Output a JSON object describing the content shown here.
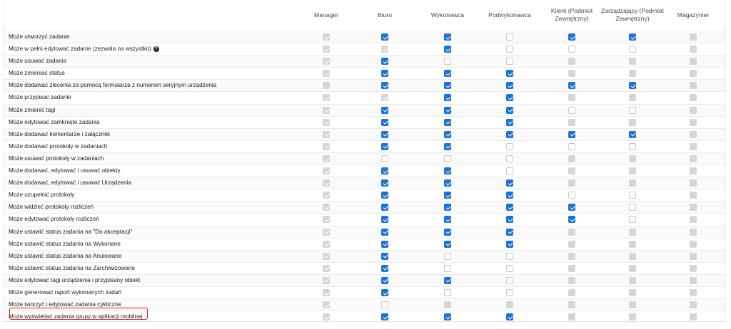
{
  "columns": [
    {
      "key": "manager",
      "label": "Manager"
    },
    {
      "key": "biuro",
      "label": "Biuro"
    },
    {
      "key": "wykonawca",
      "label": "Wykonawca"
    },
    {
      "key": "podwykonawca",
      "label": "Podwykonawca"
    },
    {
      "key": "klient",
      "label": "Klient (Podmiot Zewnętrzny)"
    },
    {
      "key": "zarzadzajacy",
      "label": "Zarządzający (Podmiot Zewnętrzny)"
    },
    {
      "key": "magazynier",
      "label": "Magazynier"
    }
  ],
  "legend": {
    "C": "checked",
    "U": "unchecked",
    "D": "disabled",
    "DC": "disabled-checked"
  },
  "permissions": [
    {
      "label": "Może utworzyć zadanie",
      "help": false,
      "states": [
        "DC",
        "C",
        "C",
        "U",
        "C",
        "C",
        "D"
      ]
    },
    {
      "label": "Może w pełni edytować zadanie (zezwala na wszystko)",
      "help": true,
      "states": [
        "DC",
        "DC",
        "C",
        "U",
        "U",
        "U",
        "D"
      ]
    },
    {
      "label": "Może usuwać zadania",
      "help": false,
      "states": [
        "DC",
        "C",
        "U",
        "U",
        "D",
        "D",
        "D"
      ]
    },
    {
      "label": "Może zmieniać status",
      "help": false,
      "states": [
        "DC",
        "C",
        "C",
        "C",
        "D",
        "D",
        "D"
      ]
    },
    {
      "label": "Może dodawać zlecenia za pomocą formularza z numerem seryjnym urządzenia",
      "help": false,
      "states": [
        "D",
        "C",
        "C",
        "C",
        "C",
        "C",
        "D"
      ]
    },
    {
      "label": "Może przypisać zadanie",
      "help": false,
      "states": [
        "DC",
        "DC",
        "C",
        "C",
        "D",
        "D",
        "D"
      ]
    },
    {
      "label": "Może zmienić tagi",
      "help": false,
      "states": [
        "DC",
        "C",
        "C",
        "C",
        "U",
        "U",
        "D"
      ]
    },
    {
      "label": "Może edytować zamknięte zadania",
      "help": false,
      "states": [
        "DC",
        "C",
        "C",
        "C",
        "D",
        "D",
        "D"
      ]
    },
    {
      "label": "Może dodawać komentarze i załączniki",
      "help": false,
      "states": [
        "DC",
        "C",
        "C",
        "C",
        "C",
        "C",
        "D"
      ]
    },
    {
      "label": "Może dodawać protokoły w zadaniach",
      "help": false,
      "states": [
        "DC",
        "C",
        "C",
        "U",
        "U",
        "U",
        "D"
      ]
    },
    {
      "label": "Może usuwać protokoły w zadaniach",
      "help": false,
      "states": [
        "DC",
        "U",
        "U",
        "U",
        "D",
        "D",
        "D"
      ]
    },
    {
      "label": "Może dodawać, edytować i usuwać obiekty",
      "help": false,
      "states": [
        "DC",
        "C",
        "C",
        "U",
        "D",
        "D",
        "D"
      ]
    },
    {
      "label": "Może dodawać, edytować i usuwać Urządzenia",
      "help": false,
      "states": [
        "DC",
        "C",
        "C",
        "C",
        "D",
        "D",
        "D"
      ]
    },
    {
      "label": "Może uzupełnić protokoły",
      "help": false,
      "states": [
        "DC",
        "C",
        "C",
        "C",
        "U",
        "U",
        "D"
      ]
    },
    {
      "label": "Może widzieć protokoły rozliczeń",
      "help": false,
      "states": [
        "DC",
        "C",
        "C",
        "C",
        "C",
        "U",
        "D"
      ]
    },
    {
      "label": "Może edytować protokoły rozliczeń",
      "help": false,
      "states": [
        "DC",
        "C",
        "C",
        "C",
        "C",
        "U",
        "D"
      ]
    },
    {
      "label": "Może ustawić status zadania na \"Do akceptacji\"",
      "help": false,
      "states": [
        "DC",
        "C",
        "C",
        "C",
        "D",
        "D",
        "D"
      ]
    },
    {
      "label": "Może ustawić status zadania na Wykonane",
      "help": false,
      "states": [
        "DC",
        "C",
        "C",
        "C",
        "D",
        "D",
        "D"
      ]
    },
    {
      "label": "Może ustawić status zadania na Anulowane",
      "help": false,
      "states": [
        "DC",
        "C",
        "U",
        "U",
        "D",
        "D",
        "D"
      ]
    },
    {
      "label": "Może ustawić status zadania na Zarchiwizowane",
      "help": false,
      "states": [
        "DC",
        "C",
        "U",
        "U",
        "D",
        "D",
        "D"
      ]
    },
    {
      "label": "Może edytować tagi urządzenia i przypisany obiekt",
      "help": false,
      "states": [
        "DC",
        "C",
        "C",
        "U",
        "D",
        "D",
        "D"
      ]
    },
    {
      "label": "Może generować raport wykonanych zadań",
      "help": false,
      "states": [
        "DC",
        "C",
        "U",
        "U",
        "D",
        "D",
        "D"
      ]
    },
    {
      "label": "Może tworzyć i edytować zadania cykliczne",
      "help": false,
      "states": [
        "DC",
        "U",
        "D",
        "D",
        "D",
        "D",
        "D"
      ]
    },
    {
      "label": "Może wyświetlać zadania grupy w aplikacji mobilnej",
      "help": false,
      "states": [
        "DC",
        "C",
        "C",
        "C",
        "D",
        "D",
        "D"
      ]
    }
  ]
}
